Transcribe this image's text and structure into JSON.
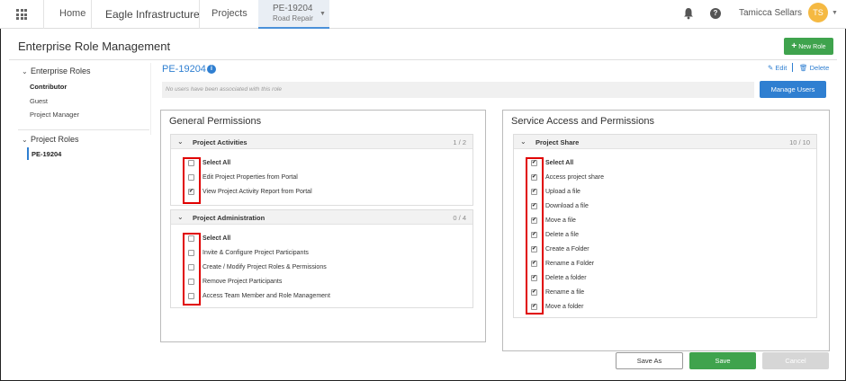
{
  "topbar": {
    "home": "Home",
    "brand": "Eagle Infrastructure",
    "projects": "Projects",
    "active_project_id": "PE-19204",
    "active_project_name": "Road Repair",
    "user_name": "Tamicca Sellars",
    "avatar_initials": "TS",
    "help_glyph": "?"
  },
  "page": {
    "title": "Enterprise Role Management",
    "new_role_label": "New Role"
  },
  "sidebar": {
    "enterprise_heading": "Enterprise Roles",
    "enterprise_items": [
      "Contributor",
      "Guest",
      "Project Manager"
    ],
    "project_heading": "Project Roles",
    "project_items": [
      "PE-19204"
    ]
  },
  "role": {
    "id": "PE-19204",
    "edit_label": "Edit",
    "delete_label": "Delete",
    "users_placeholder": "No users have been associated with this role",
    "manage_users_label": "Manage Users"
  },
  "general": {
    "title": "General Permissions",
    "groups": [
      {
        "name": "Project Activities",
        "count": "1 / 2",
        "items": [
          {
            "label": "Select All",
            "checked": false
          },
          {
            "label": "Edit Project Properties from Portal",
            "checked": false
          },
          {
            "label": "View Project Activity Report from Portal",
            "checked": true
          }
        ]
      },
      {
        "name": "Project Administration",
        "count": "0 / 4",
        "items": [
          {
            "label": "Select All",
            "checked": false
          },
          {
            "label": "Invite & Configure Project Participants",
            "checked": false
          },
          {
            "label": "Create / Modify Project Roles & Permissions",
            "checked": false
          },
          {
            "label": "Remove Project Participants",
            "checked": false
          },
          {
            "label": "Access Team Member and Role Management",
            "checked": false
          }
        ]
      }
    ]
  },
  "service": {
    "title": "Service Access and Permissions",
    "groups": [
      {
        "name": "Project Share",
        "count": "10 / 10",
        "items": [
          {
            "label": "Select All",
            "checked": true
          },
          {
            "label": "Access project share",
            "checked": true
          },
          {
            "label": "Upload a file",
            "checked": true
          },
          {
            "label": "Download a file",
            "checked": true
          },
          {
            "label": "Move a file",
            "checked": true
          },
          {
            "label": "Delete a file",
            "checked": true
          },
          {
            "label": "Create a Folder",
            "checked": true
          },
          {
            "label": "Rename a Folder",
            "checked": true
          },
          {
            "label": "Delete a folder",
            "checked": true
          },
          {
            "label": "Rename a file",
            "checked": true
          },
          {
            "label": "Move a folder",
            "checked": true
          }
        ]
      }
    ]
  },
  "footer": {
    "save_as_label": "Save As",
    "save_label": "Save",
    "cancel_label": "Cancel"
  },
  "colors": {
    "accent_blue": "#2f7fd1",
    "save_green": "#3fa34d",
    "highlight_red": "#e00000",
    "avatar_yellow": "#f5b942"
  }
}
